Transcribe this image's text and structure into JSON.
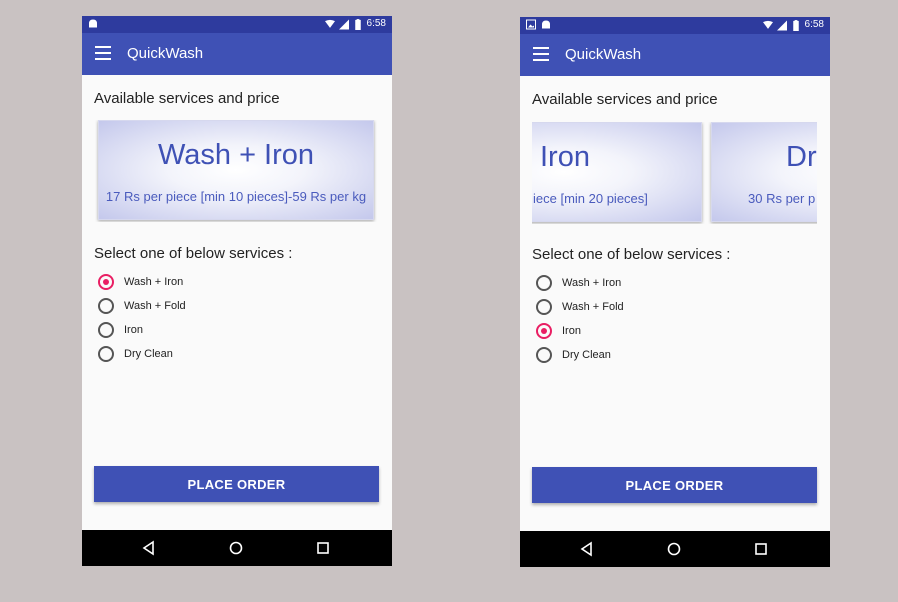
{
  "screens": [
    {
      "status": {
        "time": "6:58",
        "icons": [
          "android-icon",
          "wifi-icon",
          "signal-icon",
          "battery-icon"
        ]
      },
      "app_bar": {
        "title": "QuickWash"
      },
      "available_title": "Available services and price",
      "cards": [
        {
          "title": "Wash + Iron",
          "price": "17 Rs per piece [min 10 pieces]-59 Rs per kg"
        }
      ],
      "select_title": "Select one of below services :",
      "options": [
        {
          "label": "Wash + Iron",
          "checked": true
        },
        {
          "label": "Wash + Fold",
          "checked": false
        },
        {
          "label": "Iron",
          "checked": false
        },
        {
          "label": "Dry Clean",
          "checked": false
        }
      ],
      "button": {
        "label": "PLACE ORDER"
      }
    },
    {
      "status": {
        "time": "6:58",
        "icons": [
          "image-icon",
          "android-icon",
          "wifi-icon",
          "signal-icon",
          "battery-icon"
        ]
      },
      "app_bar": {
        "title": "QuickWash"
      },
      "available_title": "Available services and price",
      "cards": [
        {
          "title": "Iron",
          "price": "iece [min 20 pieces]"
        },
        {
          "title": "Dr",
          "price": "30 Rs per p"
        }
      ],
      "select_title": "Select one of below services :",
      "options": [
        {
          "label": "Wash + Iron",
          "checked": false
        },
        {
          "label": "Wash + Fold",
          "checked": false
        },
        {
          "label": "Iron",
          "checked": true
        },
        {
          "label": "Dry Clean",
          "checked": false
        }
      ],
      "button": {
        "label": "PLACE ORDER"
      }
    }
  ],
  "colors": {
    "primary": "#3f51b5",
    "primary_dark": "#2e3b9e",
    "accent": "#e91e63",
    "background": "#c9c2c2"
  }
}
